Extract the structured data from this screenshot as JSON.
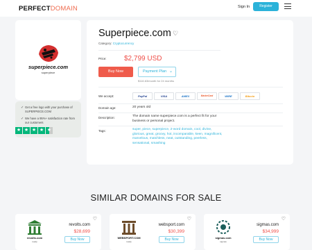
{
  "header": {
    "logo_main": "PERFECT",
    "logo_accent": "DOMAIN",
    "signin_label": "Sign In",
    "register_label": "Register"
  },
  "brand": {
    "name": "superpiece.com",
    "tagline": "superpiece"
  },
  "trust": {
    "items": [
      "Get a free logo with your purchase of SUPERPIECE.COM",
      "We have a 95%+ satisfaction rate from our customers"
    ],
    "stars": 4.5
  },
  "listing": {
    "domain": "Superpiece.com",
    "category_label": "Category:",
    "category_value": "Cryptocurrency",
    "price_label": "Price:",
    "price": "$2,799 USD",
    "buy_label": "Buy Now",
    "plan_label": "Payment Plan",
    "monthly_note": "$116.63/month for 24 months",
    "accept_label": "We accept:",
    "payment_methods": [
      "PayPal",
      "VISA",
      "AMEX",
      "MasterCard",
      "WIRE",
      "Bitcoin"
    ],
    "age_label": "Domain age:",
    "age_value": "20 years old",
    "description_label": "Description:",
    "description_value": "The domain name superpiece.com is a perfect fit for your business or personal project.",
    "tags_label": "Tags:",
    "tags_value": "super, piece, superpiece, 2-word domain, cool, divine, glorious, great, groovy, hot, incomparable, keen, magnificent, marvelous, matchless, neat, outstanding, peerless, sensational, smashing"
  },
  "similar": {
    "title": "SIMILAR DOMAINS FOR SALE",
    "buy_label": "Buy Now",
    "items": [
      {
        "name": "revolts.com",
        "price": "$28,699",
        "logo_text": "revolts.com",
        "logo_sub": "ready",
        "color": "#2e7d32"
      },
      {
        "name": "websport.com",
        "price": "$30,399",
        "logo_text": "WEBSPORT.COM",
        "logo_sub": "ready",
        "color": "#6d4c2a"
      },
      {
        "name": "sigmas.com",
        "price": "$34,999",
        "logo_text": "sigmas.com",
        "logo_sub": "sigmas",
        "color": "#1b5e5a"
      }
    ]
  },
  "colors": {
    "accent_red": "#ef5b4b",
    "accent_blue": "#2bb2d9",
    "trust_green": "#00b67a"
  }
}
